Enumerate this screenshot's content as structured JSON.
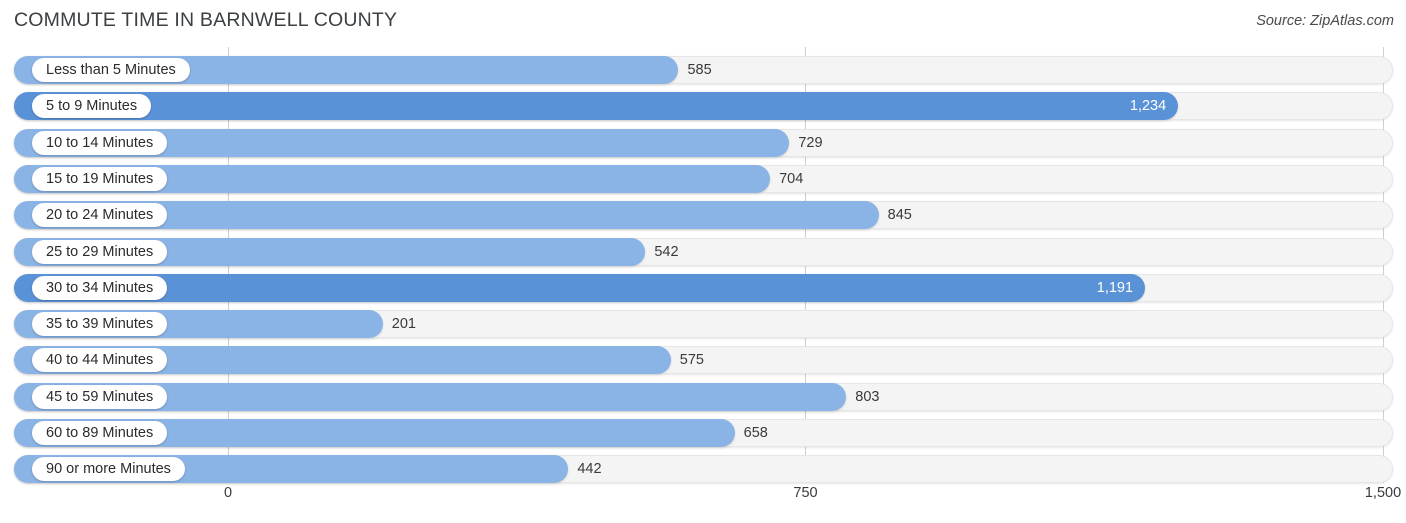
{
  "header": {
    "title": "COMMUTE TIME IN BARNWELL COUNTY",
    "source": "Source: ZipAtlas.com"
  },
  "colors": {
    "bar_light": "#8ab3e6",
    "bar_dark": "#5a92d8",
    "track": "#f4f4f4",
    "gridline": "#cfcfcf",
    "title_text": "#3c4043"
  },
  "chart_data": {
    "type": "bar",
    "orientation": "horizontal",
    "title": "COMMUTE TIME IN BARNWELL COUNTY",
    "xlabel": "",
    "ylabel": "",
    "xlim": [
      0,
      1500
    ],
    "grid": true,
    "legend": null,
    "tick_labels": [
      "0",
      "750",
      "1,500"
    ],
    "ticks": [
      0,
      750,
      1500
    ],
    "categories": [
      "Less than 5 Minutes",
      "5 to 9 Minutes",
      "10 to 14 Minutes",
      "15 to 19 Minutes",
      "20 to 24 Minutes",
      "25 to 29 Minutes",
      "30 to 34 Minutes",
      "35 to 39 Minutes",
      "40 to 44 Minutes",
      "45 to 59 Minutes",
      "60 to 89 Minutes",
      "90 or more Minutes"
    ],
    "values": [
      585,
      1234,
      729,
      704,
      845,
      542,
      1191,
      201,
      575,
      803,
      658,
      442
    ],
    "value_labels": [
      "585",
      "1,234",
      "729",
      "704",
      "845",
      "542",
      "1,191",
      "201",
      "575",
      "803",
      "658",
      "442"
    ],
    "highlighted": [
      false,
      true,
      false,
      false,
      false,
      false,
      true,
      false,
      false,
      false,
      false,
      false
    ]
  }
}
